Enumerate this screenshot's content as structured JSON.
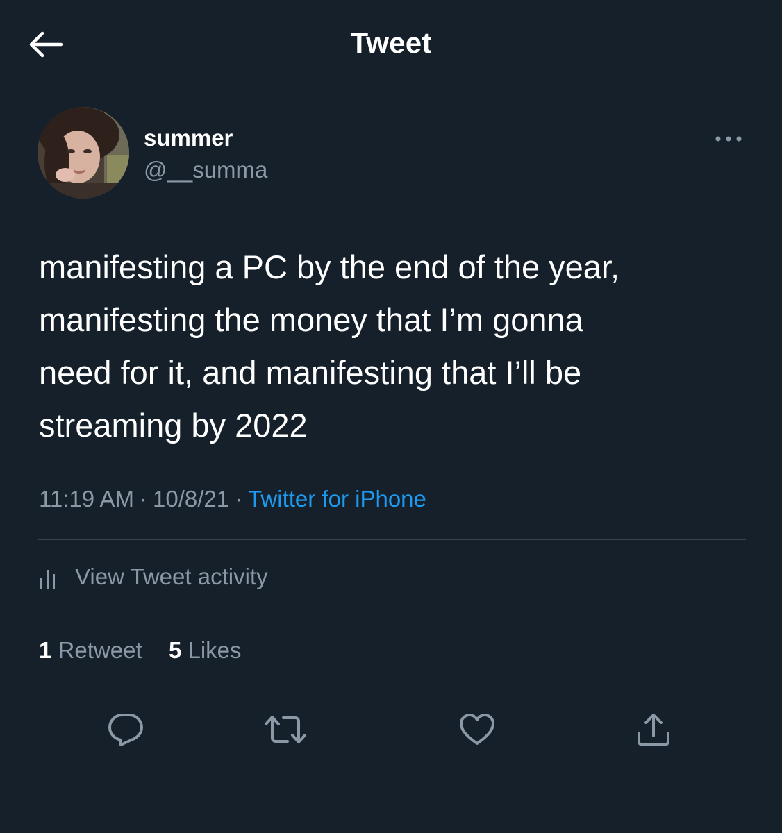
{
  "header": {
    "title": "Tweet"
  },
  "author": {
    "display_name": "summer",
    "handle": "@__summa"
  },
  "tweet": {
    "text": "manifesting a PC by the end of the year,\nmanifesting the money that I’m gonna\nneed for it, and manifesting that I’ll be\nstreaming by 2022",
    "time": "11:19 AM",
    "date": "10/8/21",
    "source": "Twitter for iPhone"
  },
  "activity": {
    "label": "View Tweet activity"
  },
  "stats": {
    "retweets_count": "1",
    "retweets_label": "Retweet",
    "likes_count": "5",
    "likes_label": "Likes"
  },
  "icons": {
    "back": "arrow-left-icon",
    "more": "more-dots-icon",
    "activity": "bar-chart-icon",
    "reply": "reply-icon",
    "retweet": "retweet-icon",
    "like": "heart-icon",
    "share": "share-icon"
  },
  "colors": {
    "background": "#15202b",
    "text_primary": "#ffffff",
    "text_secondary": "#8b98a5",
    "accent": "#1d9bf0",
    "divider": "#38444d"
  }
}
